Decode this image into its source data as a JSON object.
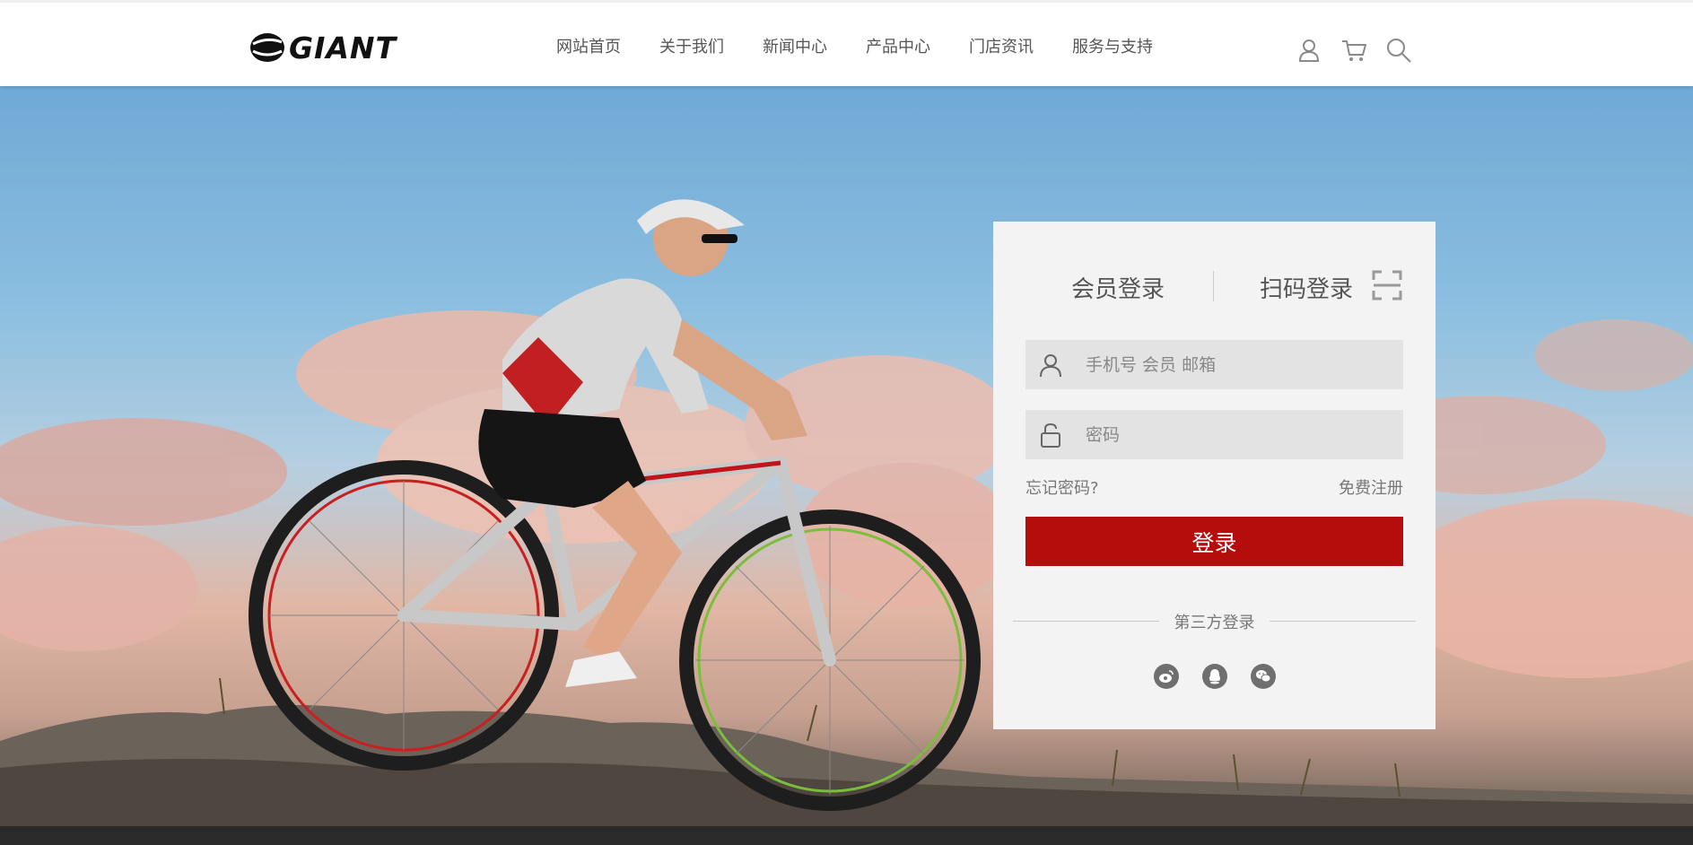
{
  "header": {
    "logo_text": "GIANT",
    "nav": [
      {
        "label": "网站首页"
      },
      {
        "label": "关于我们"
      },
      {
        "label": "新闻中心"
      },
      {
        "label": "产品中心"
      },
      {
        "label": "门店资讯"
      },
      {
        "label": "服务与支持"
      }
    ],
    "icons": [
      "user-icon",
      "cart-icon",
      "search-icon"
    ]
  },
  "login": {
    "tab_member": "会员登录",
    "tab_qr": "扫码登录",
    "username_placeholder": "手机号 会员 邮箱",
    "username_value": "",
    "password_placeholder": "密码",
    "password_value": "",
    "forgot_label": "忘记密码?",
    "register_label": "免费注册",
    "submit_label": "登录",
    "third_party_label": "第三方登录",
    "social": [
      "weibo-icon",
      "qq-icon",
      "wechat-icon"
    ]
  },
  "colors": {
    "accent": "#b50c0c",
    "panel_bg": "#f4f3f4",
    "field_bg": "#e3e3e3",
    "header_bg": "#ffffff",
    "footer_bg": "#2a2a2a"
  }
}
